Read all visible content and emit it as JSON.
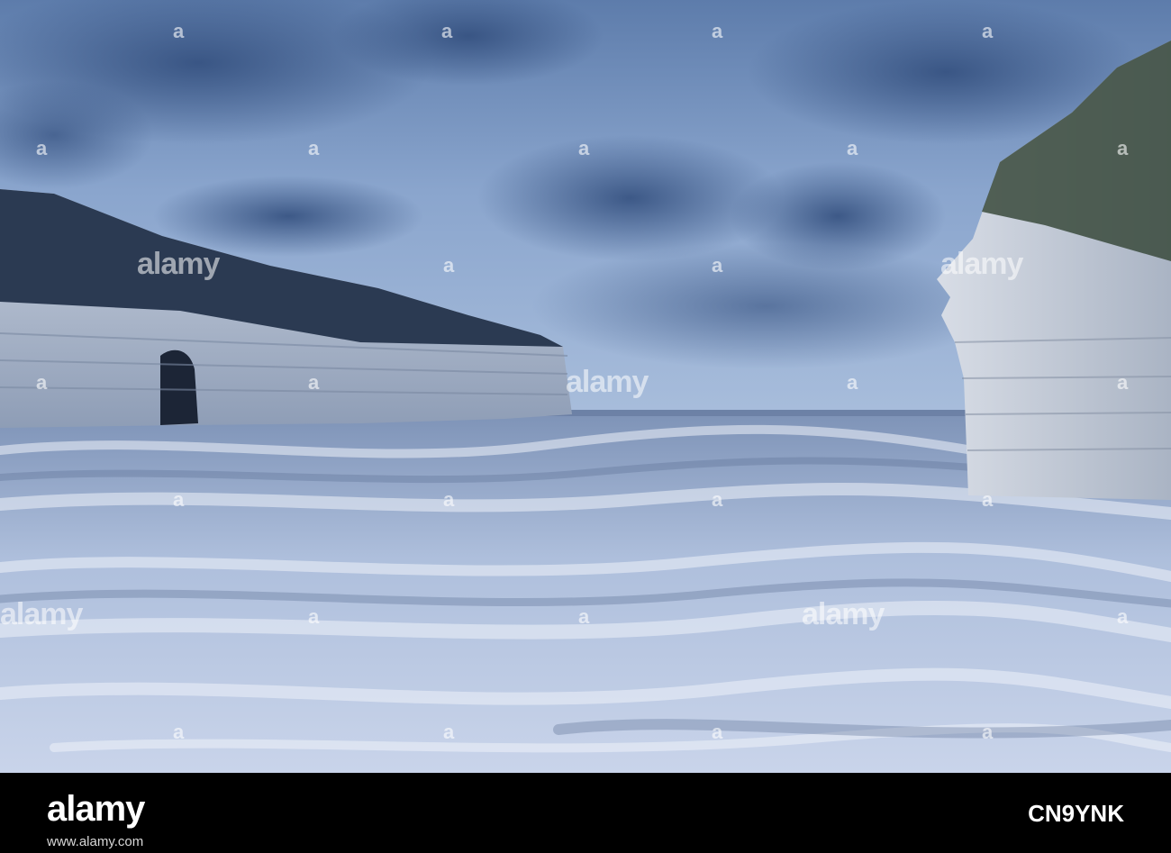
{
  "watermark": {
    "text": "alamy",
    "marker": "a"
  },
  "footer": {
    "logo": "alamy",
    "image_id": "CN9YNK",
    "url": "www.alamy.com"
  }
}
